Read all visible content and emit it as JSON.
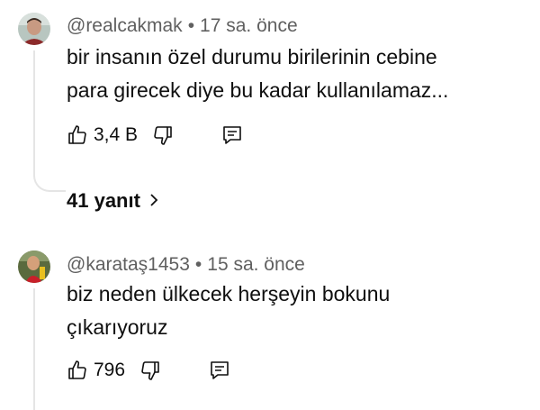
{
  "comments": [
    {
      "author": "@realcakmak",
      "time": "17 sa. önce",
      "line1": "bir insanın özel durumu  birilerinin cebine",
      "line2": "para girecek diye bu kadar kullanılamaz...",
      "likes": "3,4 B",
      "replies": "41 yanıt"
    },
    {
      "author": "@karataş1453",
      "time": "15 sa. önce",
      "line1": "biz neden ülkecek herşeyin bokunu",
      "line2": "çıkarıyoruz",
      "likes": "796"
    }
  ],
  "separator": "•",
  "icons": [
    "thumbs-up-icon",
    "thumbs-down-icon",
    "reply-icon",
    "chevron-right-icon"
  ]
}
